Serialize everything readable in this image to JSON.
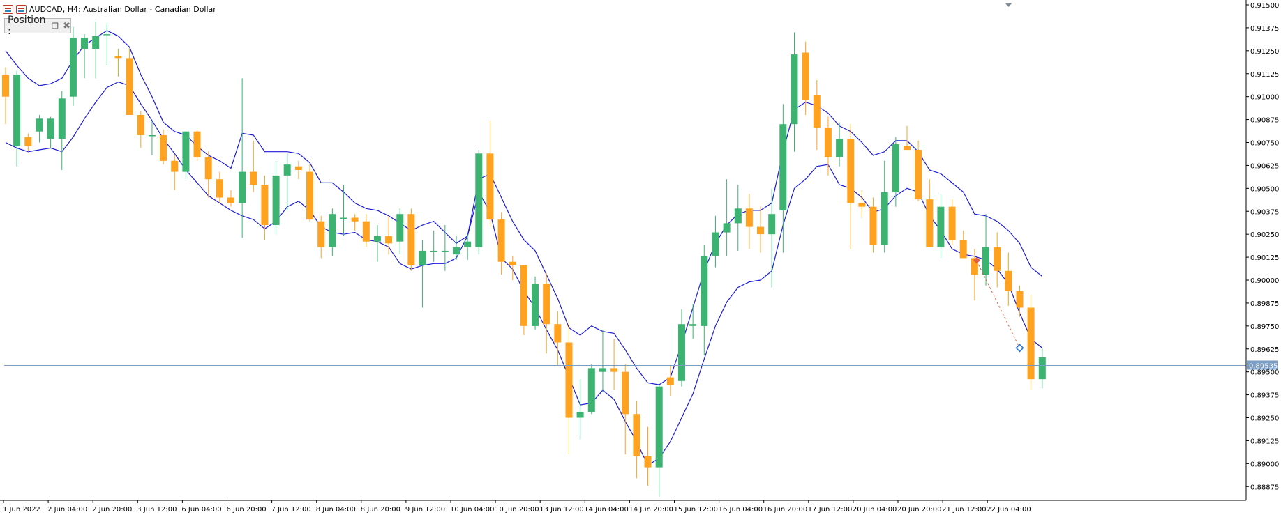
{
  "window": {
    "title": "AUDCAD, H4:  Australian Dollar - Canadian Dollar",
    "icon": "chart-window-icon"
  },
  "position_panel": {
    "label": "Position :",
    "restore_icon": "restore-icon",
    "close_icon": "close-icon"
  },
  "colors": {
    "bull": "#3cb371",
    "bear": "#ffa21f",
    "band": "#1c1cd4",
    "price_line": "#7a9ec6",
    "price_label_bg": "#7a9ec6",
    "arrow": "#e06040"
  },
  "chart_data": {
    "type": "candlestick",
    "symbol": "AUDCAD",
    "timeframe": "H4",
    "ylim": [
      0.888,
      0.915
    ],
    "y_ticks": [
      "0.91500",
      "0.91375",
      "0.91250",
      "0.91125",
      "0.91000",
      "0.90875",
      "0.90750",
      "0.90625",
      "0.90500",
      "0.90375",
      "0.90250",
      "0.90125",
      "0.90000",
      "0.89875",
      "0.89750",
      "0.89625",
      "0.89500",
      "0.89375",
      "0.89250",
      "0.89125",
      "0.89000",
      "0.88875"
    ],
    "x_ticks": [
      "1 Jun 2022",
      "2 Jun 04:00",
      "2 Jun 20:00",
      "3 Jun 12:00",
      "6 Jun 04:00",
      "6 Jun 20:00",
      "7 Jun 12:00",
      "8 Jun 04:00",
      "8 Jun 20:00",
      "9 Jun 12:00",
      "10 Jun 04:00",
      "10 Jun 20:00",
      "13 Jun 12:00",
      "14 Jun 04:00",
      "14 Jun 20:00",
      "15 Jun 12:00",
      "16 Jun 04:00",
      "16 Jun 20:00",
      "17 Jun 12:00",
      "20 Jun 04:00",
      "20 Jun 20:00",
      "21 Jun 12:00",
      "22 Jun 04:00"
    ],
    "current_price": "0.89535",
    "candles": [
      [
        0.9112,
        0.9116,
        0.9085,
        0.91
      ],
      [
        0.9073,
        0.9114,
        0.9062,
        0.9112
      ],
      [
        0.9078,
        0.908,
        0.907,
        0.9073
      ],
      [
        0.9081,
        0.909,
        0.9075,
        0.9088
      ],
      [
        0.9077,
        0.9089,
        0.9072,
        0.9088
      ],
      [
        0.9077,
        0.9103,
        0.906,
        0.9099
      ],
      [
        0.91,
        0.9138,
        0.9095,
        0.9132
      ],
      [
        0.9126,
        0.9134,
        0.911,
        0.9132
      ],
      [
        0.9126,
        0.9141,
        0.911,
        0.9133
      ],
      [
        0.9134,
        0.914,
        0.9117,
        0.9134
      ],
      [
        0.9122,
        0.9126,
        0.9111,
        0.9121
      ],
      [
        0.9121,
        0.9126,
        0.9102,
        0.909
      ],
      [
        0.909,
        0.9092,
        0.9072,
        0.9079
      ],
      [
        0.9079,
        0.9087,
        0.9068,
        0.9079
      ],
      [
        0.9079,
        0.9082,
        0.9063,
        0.9065
      ],
      [
        0.9065,
        0.9068,
        0.9049,
        0.9059
      ],
      [
        0.9059,
        0.9081,
        0.9055,
        0.9081
      ],
      [
        0.9081,
        0.9082,
        0.9065,
        0.9067
      ],
      [
        0.9067,
        0.907,
        0.9045,
        0.9055
      ],
      [
        0.9055,
        0.9059,
        0.9042,
        0.9045
      ],
      [
        0.9045,
        0.9049,
        0.904,
        0.9042
      ],
      [
        0.9042,
        0.911,
        0.9023,
        0.9059
      ],
      [
        0.9059,
        0.9076,
        0.9048,
        0.9052
      ],
      [
        0.9052,
        0.9057,
        0.9022,
        0.903
      ],
      [
        0.903,
        0.9065,
        0.9025,
        0.9057
      ],
      [
        0.9057,
        0.9069,
        0.9038,
        0.9063
      ],
      [
        0.9062,
        0.9065,
        0.9055,
        0.906
      ],
      [
        0.9059,
        0.9063,
        0.9032,
        0.9033
      ],
      [
        0.9032,
        0.9035,
        0.9012,
        0.9018
      ],
      [
        0.9018,
        0.9039,
        0.9013,
        0.9036
      ],
      [
        0.9034,
        0.9052,
        0.9024,
        0.9034
      ],
      [
        0.9034,
        0.9036,
        0.9027,
        0.9032
      ],
      [
        0.9032,
        0.9036,
        0.9018,
        0.9021
      ],
      [
        0.9021,
        0.903,
        0.901,
        0.9024
      ],
      [
        0.9024,
        0.9035,
        0.9014,
        0.902
      ],
      [
        0.9021,
        0.9039,
        0.9014,
        0.9036
      ],
      [
        0.9036,
        0.9039,
        0.9005,
        0.9008
      ],
      [
        0.9008,
        0.9022,
        0.8985,
        0.9016
      ],
      [
        0.9016,
        0.9027,
        0.901,
        0.9016
      ],
      [
        0.9016,
        0.903,
        0.9005,
        0.9016
      ],
      [
        0.9014,
        0.9024,
        0.9011,
        0.9018
      ],
      [
        0.9018,
        0.9025,
        0.9011,
        0.9021
      ],
      [
        0.9018,
        0.9071,
        0.9014,
        0.9069
      ],
      [
        0.9069,
        0.9087,
        0.9029,
        0.9033
      ],
      [
        0.9033,
        0.9037,
        0.9003,
        0.901
      ],
      [
        0.901,
        0.9013,
        0.9,
        0.9008
      ],
      [
        0.9008,
        0.9008,
        0.897,
        0.8975
      ],
      [
        0.8975,
        0.9002,
        0.8973,
        0.8998
      ],
      [
        0.8998,
        0.9004,
        0.896,
        0.8976
      ],
      [
        0.8976,
        0.8983,
        0.8953,
        0.8966
      ],
      [
        0.8966,
        0.8978,
        0.8905,
        0.8925
      ],
      [
        0.8925,
        0.8946,
        0.8913,
        0.8928
      ],
      [
        0.8928,
        0.8954,
        0.8927,
        0.8952
      ],
      [
        0.895,
        0.8973,
        0.8939,
        0.8952
      ],
      [
        0.8952,
        0.8968,
        0.894,
        0.895
      ],
      [
        0.895,
        0.8954,
        0.8905,
        0.8927
      ],
      [
        0.8927,
        0.8934,
        0.8892,
        0.8904
      ],
      [
        0.8904,
        0.892,
        0.8888,
        0.8898
      ],
      [
        0.8898,
        0.8943,
        0.8882,
        0.8942
      ],
      [
        0.8947,
        0.8953,
        0.8937,
        0.8943
      ],
      [
        0.8945,
        0.8984,
        0.8942,
        0.8976
      ],
      [
        0.8975,
        0.8987,
        0.8968,
        0.8976
      ],
      [
        0.8975,
        0.9019,
        0.8959,
        0.9013
      ],
      [
        0.9013,
        0.9035,
        0.9007,
        0.9026
      ],
      [
        0.9026,
        0.9055,
        0.9013,
        0.9031
      ],
      [
        0.9031,
        0.9052,
        0.9016,
        0.9039
      ],
      [
        0.9039,
        0.9047,
        0.9017,
        0.9029
      ],
      [
        0.9029,
        0.904,
        0.9015,
        0.9025
      ],
      [
        0.9025,
        0.905,
        0.8996,
        0.9036
      ],
      [
        0.9038,
        0.9096,
        0.9015,
        0.9085
      ],
      [
        0.9085,
        0.9135,
        0.907,
        0.9123
      ],
      [
        0.9124,
        0.913,
        0.909,
        0.9098
      ],
      [
        0.9101,
        0.9109,
        0.9071,
        0.9083
      ],
      [
        0.9083,
        0.9089,
        0.9057,
        0.9067
      ],
      [
        0.9067,
        0.9086,
        0.9062,
        0.9077
      ],
      [
        0.9077,
        0.9085,
        0.9017,
        0.9042
      ],
      [
        0.9042,
        0.9049,
        0.9034,
        0.904
      ],
      [
        0.904,
        0.9045,
        0.9015,
        0.9019
      ],
      [
        0.9019,
        0.9065,
        0.9015,
        0.9048
      ],
      [
        0.9048,
        0.9078,
        0.904,
        0.9074
      ],
      [
        0.9073,
        0.9084,
        0.9071,
        0.9071
      ],
      [
        0.9071,
        0.9076,
        0.9043,
        0.9044
      ],
      [
        0.9044,
        0.9055,
        0.9019,
        0.9018
      ],
      [
        0.9018,
        0.9047,
        0.9012,
        0.904
      ],
      [
        0.904,
        0.9044,
        0.9019,
        0.9022
      ],
      [
        0.9022,
        0.9027,
        0.9013,
        0.9012
      ],
      [
        0.9012,
        0.9017,
        0.8989,
        0.9003
      ],
      [
        0.9003,
        0.9036,
        0.8997,
        0.9018
      ],
      [
        0.9018,
        0.9026,
        0.8996,
        0.9005
      ],
      [
        0.9005,
        0.9015,
        0.8986,
        0.8994
      ],
      [
        0.8994,
        0.8997,
        0.898,
        0.8985
      ],
      [
        0.8985,
        0.8992,
        0.894,
        0.8946
      ],
      [
        0.8946,
        0.8963,
        0.8941,
        0.8958
      ]
    ],
    "upper_band": [
      0.9125,
      0.9117,
      0.911,
      0.9106,
      0.9107,
      0.911,
      0.912,
      0.9128,
      0.9132,
      0.9136,
      0.9133,
      0.9127,
      0.9112,
      0.91,
      0.9086,
      0.9081,
      0.9079,
      0.9073,
      0.9068,
      0.9065,
      0.9061,
      0.908,
      0.9079,
      0.907,
      0.907,
      0.907,
      0.9069,
      0.9064,
      0.9053,
      0.9053,
      0.9048,
      0.9042,
      0.9039,
      0.9038,
      0.9035,
      0.9031,
      0.9027,
      0.903,
      0.9032,
      0.9026,
      0.902,
      0.9024,
      0.9055,
      0.9058,
      0.9045,
      0.9032,
      0.9022,
      0.9016,
      0.9003,
      0.899,
      0.8974,
      0.897,
      0.8975,
      0.8972,
      0.8971,
      0.8962,
      0.8952,
      0.8944,
      0.8943,
      0.8947,
      0.8965,
      0.8985,
      0.9005,
      0.902,
      0.903,
      0.9036,
      0.9038,
      0.9038,
      0.9042,
      0.907,
      0.9093,
      0.9097,
      0.9095,
      0.9091,
      0.9084,
      0.9081,
      0.9075,
      0.9068,
      0.907,
      0.9076,
      0.9076,
      0.907,
      0.906,
      0.9058,
      0.9053,
      0.9048,
      0.9036,
      0.9035,
      0.9032,
      0.9027,
      0.902,
      0.9007,
      0.9002
    ],
    "lower_band": [
      0.9075,
      0.9072,
      0.907,
      0.9071,
      0.9072,
      0.907,
      0.9078,
      0.9088,
      0.9097,
      0.9105,
      0.9108,
      0.9106,
      0.9096,
      0.9087,
      0.9077,
      0.9069,
      0.906,
      0.9053,
      0.9046,
      0.9042,
      0.9038,
      0.9035,
      0.9033,
      0.9028,
      0.9032,
      0.904,
      0.9043,
      0.9038,
      0.9029,
      0.9026,
      0.9025,
      0.9026,
      0.9022,
      0.9021,
      0.9018,
      0.9009,
      0.9006,
      0.9008,
      0.9009,
      0.9009,
      0.9012,
      0.9024,
      0.9048,
      0.9037,
      0.9012,
      0.9006,
      0.8994,
      0.8985,
      0.8973,
      0.8962,
      0.8947,
      0.8932,
      0.8933,
      0.894,
      0.8935,
      0.8923,
      0.8912,
      0.8899,
      0.8903,
      0.8912,
      0.8925,
      0.8938,
      0.8957,
      0.8975,
      0.8988,
      0.8996,
      0.8999,
      0.9,
      0.9005,
      0.903,
      0.905,
      0.9055,
      0.9062,
      0.9063,
      0.9052,
      0.905,
      0.9045,
      0.9037,
      0.9039,
      0.9046,
      0.905,
      0.9048,
      0.9035,
      0.9027,
      0.9017,
      0.9014,
      0.9013,
      0.9011,
      0.9006,
      0.8998,
      0.8982,
      0.8968,
      0.8963
    ],
    "arrow": {
      "from_index": 86,
      "from_price": 0.90105,
      "to_index": 90,
      "to_price": 0.8963
    }
  }
}
